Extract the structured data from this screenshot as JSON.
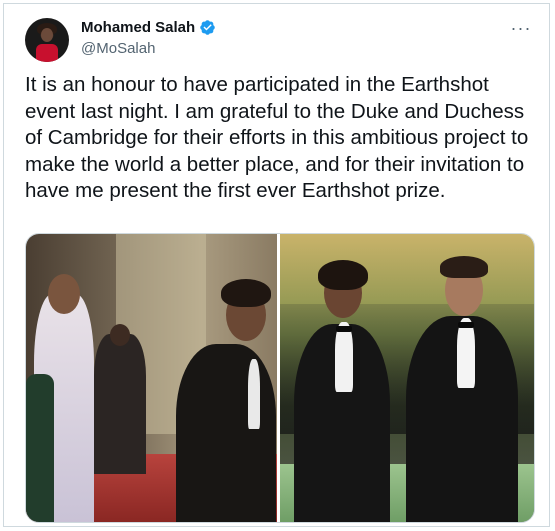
{
  "author": {
    "name": "Mohamed Salah",
    "handle": "@MoSalah",
    "verified": true
  },
  "tweet": {
    "text": "It is an honour to have participated in the Earthshot event last night. I am grateful to the Duke and Duchess of Cambridge for their efforts in this ambitious project to make the world a better place, and for their invitation to have me present the first ever Earthshot prize."
  },
  "colors": {
    "text": "#0f1419",
    "secondary": "#536471",
    "border": "#cfd9de",
    "verified": "#1d9bf0"
  },
  "icons": {
    "verified": "verified-badge-icon",
    "more": "more-options-icon"
  },
  "media": {
    "count": 2
  }
}
